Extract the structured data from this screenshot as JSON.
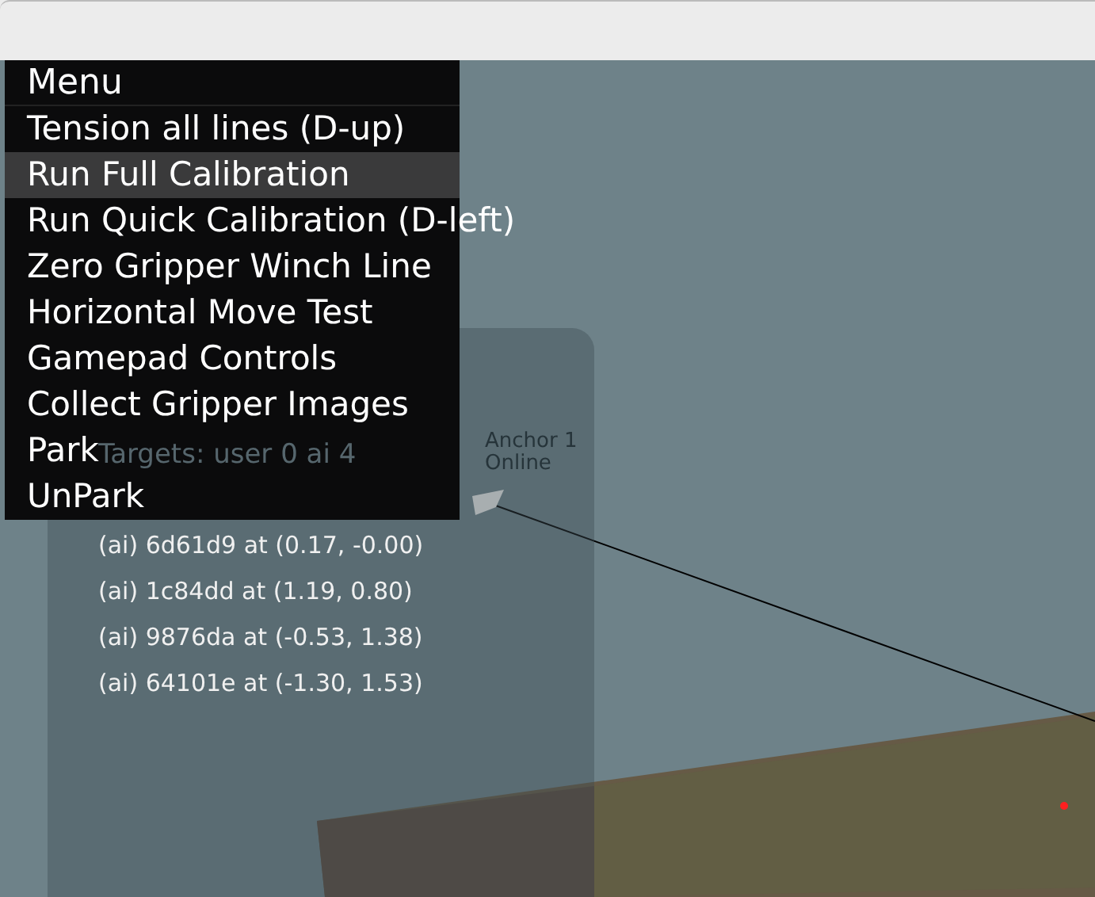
{
  "menu": {
    "title": "Menu",
    "items": [
      {
        "label": "Tension all lines (D-up)",
        "selected": false
      },
      {
        "label": "Run Full Calibration",
        "selected": true
      },
      {
        "label": "Run Quick Calibration (D-left)",
        "selected": false
      },
      {
        "label": "Zero Gripper Winch Line",
        "selected": false
      },
      {
        "label": "Horizontal Move Test",
        "selected": false
      },
      {
        "label": "Gamepad Controls",
        "selected": false
      },
      {
        "label": "Collect Gripper Images",
        "selected": false
      },
      {
        "label": "Park",
        "selected": false
      },
      {
        "label": "UnPark",
        "selected": false
      }
    ]
  },
  "info_panel": {
    "targets_summary": "Targets: user 0 ai 4",
    "targets": [
      "(ai) 6d61d9 at (0.17, -0.00)",
      "(ai) 1c84dd at (1.19, 0.80)",
      "(ai) 9876da at (-0.53, 1.38)",
      "(ai) 64101e at (-1.30, 1.53)"
    ]
  },
  "anchor": {
    "name": "Anchor 1",
    "status": "Online"
  }
}
